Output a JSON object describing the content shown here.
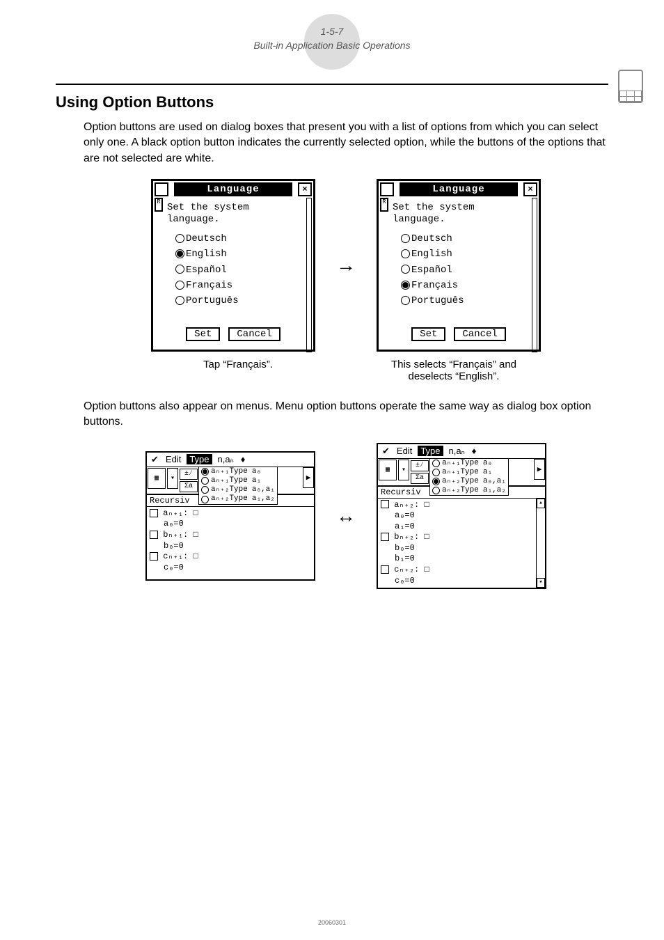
{
  "header": {
    "pagecode": "1-5-7",
    "subtitle": "Built-in Application Basic Operations"
  },
  "heading": "Using Option Buttons",
  "para1": "Option buttons are used on dialog boxes that present you with a list of options from which you can select only one. A black option button indicates the currently selected option, while the buttons of the options that are not selected are white.",
  "dialog": {
    "title": "Language",
    "close": "×",
    "message1": "Set the system",
    "message2": "language.",
    "options": [
      "Deutsch",
      "English",
      "Español",
      "Français",
      "Português"
    ],
    "set": "Set",
    "cancel": "Cancel"
  },
  "caption_left": "Tap “Français”.",
  "caption_right_l1": "This selects “Français” and",
  "caption_right_l2": "deselects “English”.",
  "para2": "Option buttons also appear on menus. Menu option buttons operate the same way as dialog box option buttons.",
  "seq": {
    "menu": {
      "edit": "Edit",
      "type": "Type",
      "nan": "n,aₙ",
      "diamond": "♦"
    },
    "type_menu": {
      "r1": {
        "label": "aₙ₊₁Type",
        "col2": "a₀"
      },
      "r2": {
        "label": "aₙ₊₁Type",
        "col2": "a₁"
      },
      "r3": {
        "label": "aₙ₊₂Type",
        "col2": "a₀,a₁"
      },
      "r4": {
        "label": "aₙ₊₂Type",
        "col2": "a₁,a₂"
      }
    },
    "section": "Recursiv",
    "left_lines": [
      "aₙ₊₁: □",
      "  a₀=0",
      "bₙ₊₁: □",
      "  b₀=0",
      "cₙ₊₁: □",
      "  c₀=0"
    ],
    "right_lines": [
      "aₙ₊₂: □",
      "  a₀=0",
      "  a₁=0",
      "bₙ₊₂: □",
      "  b₀=0",
      "  b₁=0",
      "cₙ₊₂: □",
      "  c₀=0"
    ]
  },
  "footer": "20060301"
}
